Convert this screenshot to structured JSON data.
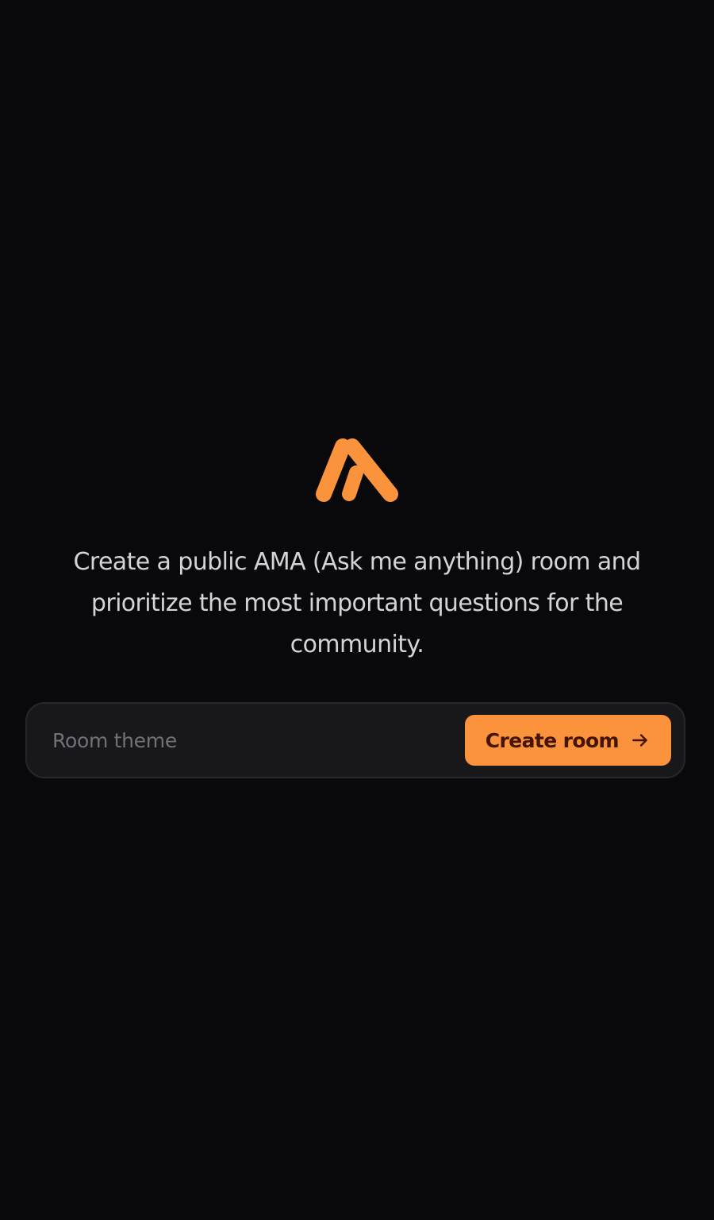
{
  "brand": {
    "logo_icon": "ama-logo-icon",
    "accent_color": "#fb923c"
  },
  "hero": {
    "tagline": "Create a public AMA (Ask me anything) room and prioritize the most important questions for the community."
  },
  "create_form": {
    "theme_placeholder": "Room theme",
    "theme_value": "",
    "submit_label": "Create room",
    "submit_icon": "arrow-right-icon"
  }
}
